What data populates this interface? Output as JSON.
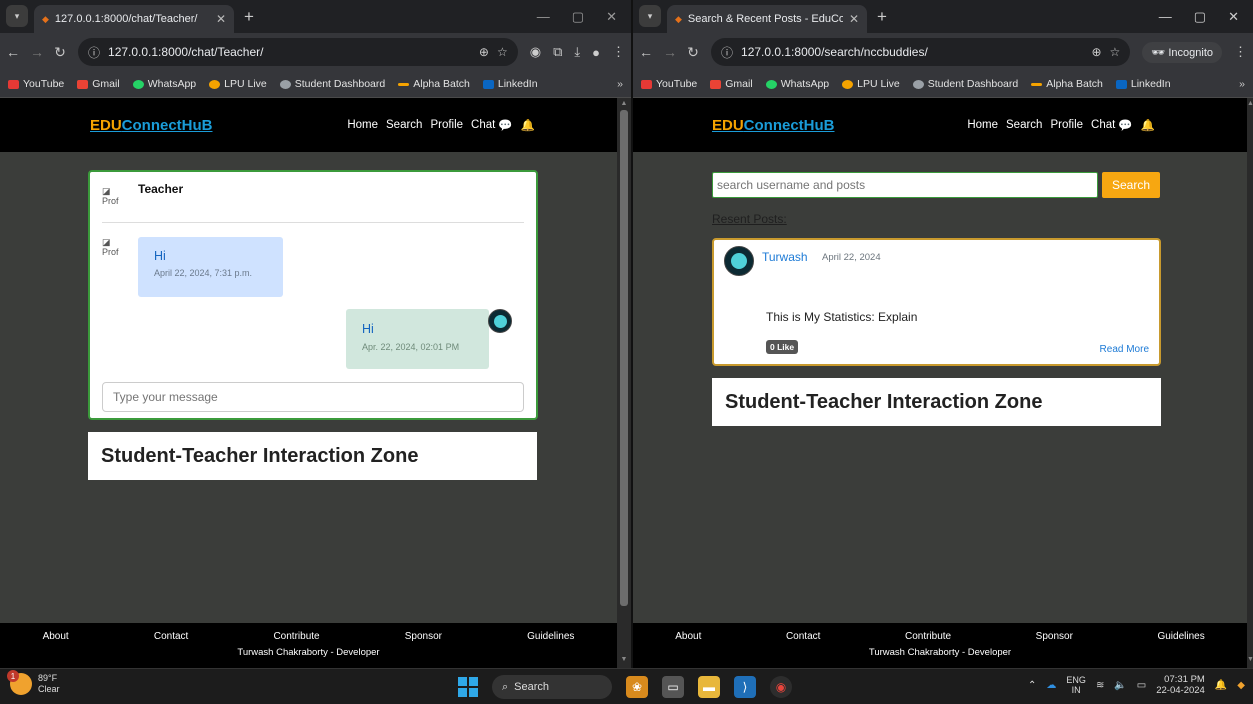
{
  "left": {
    "tab": {
      "title": "127.0.0.1:8000/chat/Teacher/"
    },
    "url": "127.0.0.1:8000/chat/Teacher/",
    "site": {
      "brand_edu": "EDU",
      "brand_rest": "ConnectHuB",
      "nav": [
        "Home",
        "Search",
        "Profile",
        "Chat"
      ],
      "chat": {
        "partner_alt": "Prof",
        "partner_name": "Teacher",
        "msg_in": {
          "alt": "Prof",
          "text": "Hi",
          "time": "April 22, 2024, 7:31 p.m."
        },
        "msg_out": {
          "text": "Hi",
          "time": "Apr. 22, 2024, 02:01 PM"
        },
        "input_placeholder": "Type your message"
      },
      "zone": "Student-Teacher Interaction Zone",
      "footer": {
        "links": [
          "About",
          "Contact",
          "Contribute",
          "Sponsor",
          "Guidelines"
        ],
        "dev": "Turwash Chakraborty - Developer"
      }
    }
  },
  "right": {
    "tab": {
      "title": "Search & Recent Posts - EduCo"
    },
    "url": "127.0.0.1:8000/search/nccbuddies/",
    "incognito": "Incognito",
    "site": {
      "brand_edu": "EDU",
      "brand_rest": "ConnectHuB",
      "nav": [
        "Home",
        "Search",
        "Profile",
        "Chat"
      ],
      "search_placeholder": "search username and posts",
      "search_button": "Search",
      "recent_label": "Resent Posts:",
      "post": {
        "author": "Turwash",
        "date": "April 22, 2024",
        "title": "This is My Statistics: Explain",
        "likes": "0 Like",
        "read_more": "Read More"
      },
      "zone": "Student-Teacher Interaction Zone",
      "footer": {
        "links": [
          "About",
          "Contact",
          "Contribute",
          "Sponsor",
          "Guidelines"
        ],
        "dev": "Turwash Chakraborty - Developer"
      }
    }
  },
  "bookmarks": [
    "YouTube",
    "Gmail",
    "WhatsApp",
    "LPU Live",
    "Student Dashboard",
    "Alpha Batch",
    "LinkedIn"
  ],
  "bookmark_colors": [
    "#e53935",
    "#ea4335",
    "#25d366",
    "#f5a300",
    "#9aa0a6",
    "#f5a300",
    "#0a66c2"
  ],
  "taskbar": {
    "weather_temp": "89°F",
    "weather_desc": "Clear",
    "weather_badge": "1",
    "search": "Search",
    "lang1": "ENG",
    "lang2": "IN",
    "time": "07:31 PM",
    "date": "22-04-2024"
  },
  "accent": {
    "brand_orange": "#f5a300",
    "brand_blue": "#1a9cd8",
    "green_border": "#3b9a3b"
  }
}
